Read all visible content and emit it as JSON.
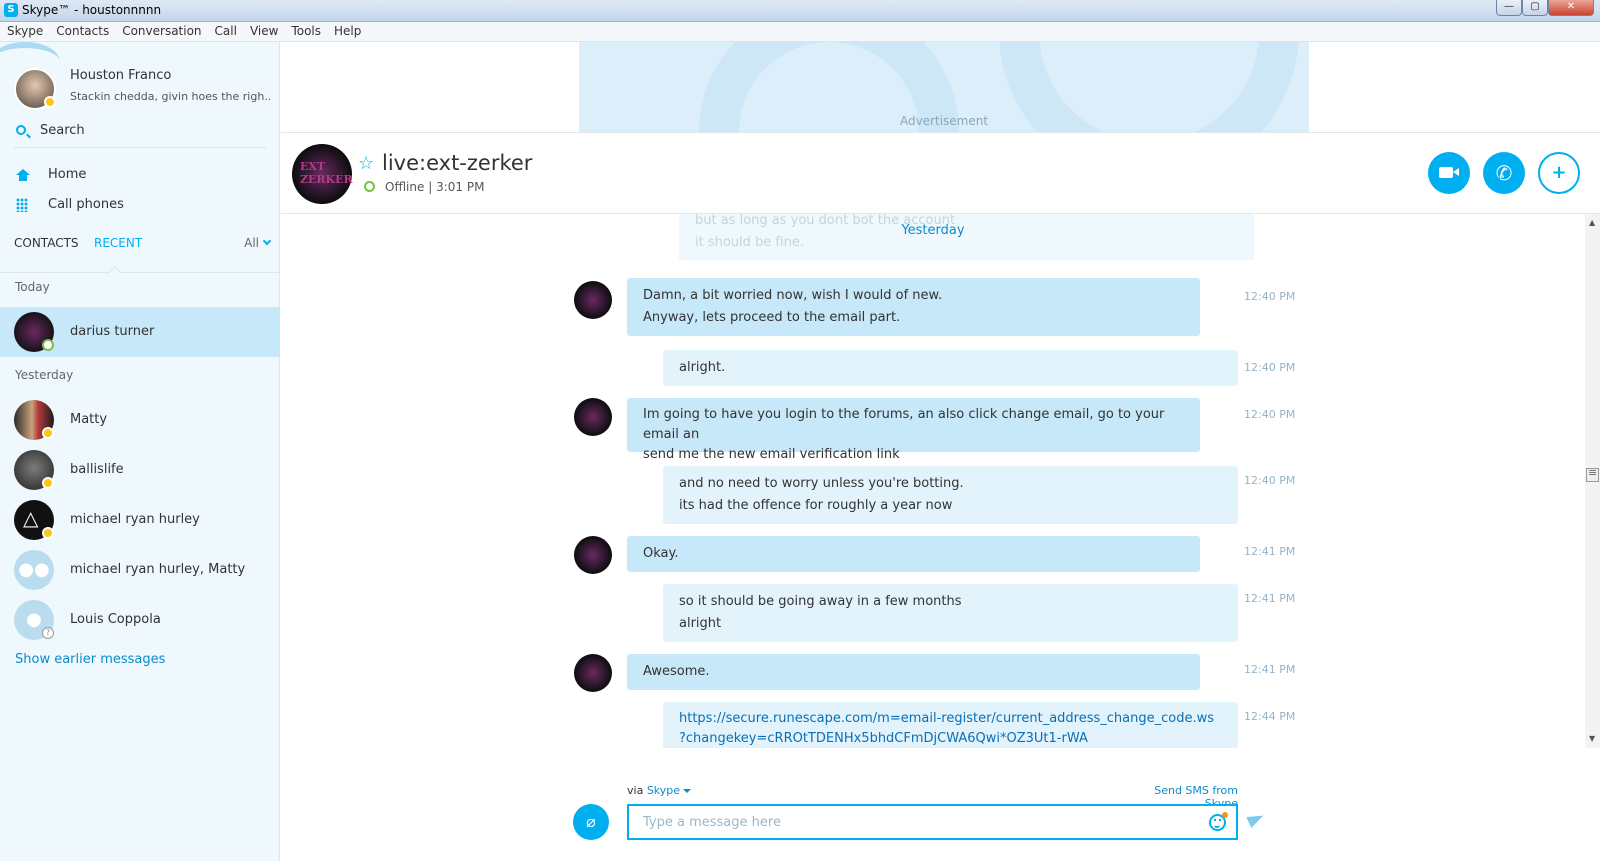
{
  "window": {
    "title": "Skype™ - houstonnnnn",
    "app_icon": "S"
  },
  "menubar": [
    "Skype",
    "Contacts",
    "Conversation",
    "Call",
    "View",
    "Tools",
    "Help"
  ],
  "profile": {
    "name": "Houston Franco",
    "mood": "Stackin chedda, givin hoes the righ...",
    "status": "away"
  },
  "sidebar": {
    "search_label": "Search",
    "nav": [
      {
        "label": "Home",
        "icon": "home-icon"
      },
      {
        "label": "Call phones",
        "icon": "dialpad-icon"
      }
    ],
    "tabs": {
      "contacts": "CONTACTS",
      "recent": "RECENT",
      "filter": "All"
    },
    "sections": {
      "today": "Today",
      "yesterday": "Yesterday"
    },
    "contacts": [
      {
        "name": "darius turner",
        "status": "online",
        "selected": true
      },
      {
        "name": "Matty",
        "status": "away"
      },
      {
        "name": "ballislife",
        "status": "away"
      },
      {
        "name": "michael ryan hurley",
        "status": "away"
      },
      {
        "name": "michael ryan hurley, Matty",
        "status": "group"
      },
      {
        "name": "Louis Coppola",
        "status": "unknown"
      }
    ],
    "show_earlier": "Show earlier messages"
  },
  "ad": {
    "label": "Advertisement"
  },
  "conversation": {
    "title": "live:ext-zerker",
    "status": "Offline",
    "separator": "|",
    "local_time": "3:01 PM",
    "avatar_text": "EXT ZERKER"
  },
  "messages": {
    "faded": [
      "but as long as you dont bot the account",
      "it should be fine."
    ],
    "day_label": "Yesterday",
    "items": [
      {
        "dir": "in",
        "lines": [
          "Damn, a bit worried now, wish I would of new.",
          "Anyway, lets proceed to the email part."
        ],
        "time": "12:40 PM"
      },
      {
        "dir": "out",
        "lines": [
          "alright."
        ],
        "time": "12:40 PM"
      },
      {
        "dir": "in",
        "lines": [
          "Im going to have you login to the forums, an also click change email, go to your email an",
          "send me the new email verification link"
        ],
        "time": "12:40 PM"
      },
      {
        "dir": "out",
        "lines": [
          "and no need to worry unless you're botting.",
          "its had the offence for roughly a year now"
        ],
        "time": "12:40 PM"
      },
      {
        "dir": "in",
        "lines": [
          "Okay."
        ],
        "time": "12:41 PM"
      },
      {
        "dir": "out",
        "lines": [
          "so it should be going away in a few months",
          "alright"
        ],
        "time": "12:41 PM"
      },
      {
        "dir": "in",
        "lines": [
          "Awesome."
        ],
        "time": "12:41 PM"
      },
      {
        "dir": "out",
        "lines": [
          "https://secure.runescape.com/m=email-register/current_address_change_code.ws",
          "?changekey=cRROtTDENHx5bhdCFmDjCWA6Qwi*OZ3Ut1-rWA"
        ],
        "time": "12:44 PM",
        "link": true
      }
    ]
  },
  "composer": {
    "via_prefix": "via",
    "via_service": "Skype",
    "sms_link": "Send SMS from Skype",
    "placeholder": "Type a message here"
  },
  "colors": {
    "accent": "#00aff0",
    "selected_row": "#c7e8f8",
    "incoming_bubble": "#c7e8f8",
    "outgoing_bubble": "#e3f3fc",
    "away": "#ffc61a",
    "online": "#7ac143"
  }
}
